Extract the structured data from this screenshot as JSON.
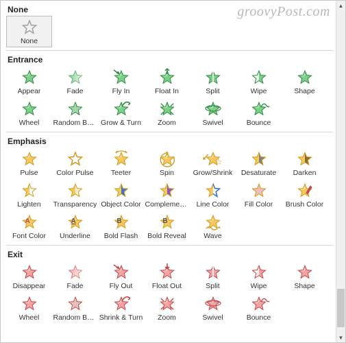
{
  "watermark": "groovyPost.com",
  "colors": {
    "none_fill": "#ffffff",
    "none_stroke": "#a0a0a0",
    "entrance_fill": "#7bd18a",
    "entrance_stroke": "#2e8b3d",
    "emphasis_fill": "#f6c95e",
    "emphasis_stroke": "#d39a1d",
    "exit_fill": "#f3a3a3",
    "exit_stroke": "#c54848",
    "accent_red": "#c54848",
    "accent_blue": "#3a78c5",
    "accent_purple": "#8a5bbd",
    "accent_brown": "#8a6a3a",
    "accent_grey": "#808080"
  },
  "sections": [
    {
      "title": "None",
      "kind": "none",
      "items": [
        {
          "label": "None",
          "style": "outline",
          "selected": true
        }
      ]
    },
    {
      "title": "Entrance",
      "kind": "entrance",
      "items": [
        {
          "label": "Appear"
        },
        {
          "label": "Fade",
          "style": "faded"
        },
        {
          "label": "Fly In",
          "accent": "arrow-in"
        },
        {
          "label": "Float In",
          "accent": "arrow-up"
        },
        {
          "label": "Split",
          "style": "split"
        },
        {
          "label": "Wipe",
          "style": "half-fade"
        },
        {
          "label": "Shape"
        },
        {
          "label": "Wheel"
        },
        {
          "label": "Random Bars",
          "style": "bars"
        },
        {
          "label": "Grow & Turn",
          "accent": "curve"
        },
        {
          "label": "Zoom",
          "accent": "zoom-out"
        },
        {
          "label": "Swivel",
          "accent": "swivel"
        },
        {
          "label": "Bounce",
          "accent": "bounce"
        }
      ]
    },
    {
      "title": "Emphasis",
      "kind": "emphasis",
      "items": [
        {
          "label": "Pulse"
        },
        {
          "label": "Color Pulse",
          "style": "outline"
        },
        {
          "label": "Teeter",
          "accent": "teeter"
        },
        {
          "label": "Spin",
          "accent": "spin"
        },
        {
          "label": "Grow/Shrink",
          "accent": "growshrink"
        },
        {
          "label": "Desaturate",
          "style": "grey-half"
        },
        {
          "label": "Darken",
          "style": "dark-half"
        },
        {
          "label": "Lighten",
          "style": "light-half"
        },
        {
          "label": "Transparency",
          "style": "trans-half"
        },
        {
          "label": "Object Color",
          "style": "blue-half"
        },
        {
          "label": "Complemen...",
          "style": "purple-half"
        },
        {
          "label": "Line Color",
          "style": "blue-outline-half"
        },
        {
          "label": "Fill Color",
          "style": "red-fill"
        },
        {
          "label": "Brush Color",
          "accent": "brush"
        },
        {
          "label": "Font Color",
          "accent": "letter-red"
        },
        {
          "label": "Underline",
          "accent": "letter-u"
        },
        {
          "label": "Bold Flash",
          "accent": "letter-b"
        },
        {
          "label": "Bold Reveal",
          "accent": "letter-b2"
        },
        {
          "label": "Wave",
          "accent": "wave"
        }
      ]
    },
    {
      "title": "Exit",
      "kind": "exit",
      "items": [
        {
          "label": "Disappear"
        },
        {
          "label": "Fade",
          "style": "faded"
        },
        {
          "label": "Fly Out",
          "accent": "arrow-out"
        },
        {
          "label": "Float Out",
          "accent": "arrow-down"
        },
        {
          "label": "Split",
          "style": "split"
        },
        {
          "label": "Wipe",
          "style": "half-fade"
        },
        {
          "label": "Shape"
        },
        {
          "label": "Wheel"
        },
        {
          "label": "Random Bars",
          "style": "bars"
        },
        {
          "label": "Shrink & Turn",
          "accent": "curve"
        },
        {
          "label": "Zoom",
          "accent": "zoom-in"
        },
        {
          "label": "Swivel",
          "accent": "swivel"
        },
        {
          "label": "Bounce",
          "accent": "bounce"
        }
      ]
    }
  ]
}
